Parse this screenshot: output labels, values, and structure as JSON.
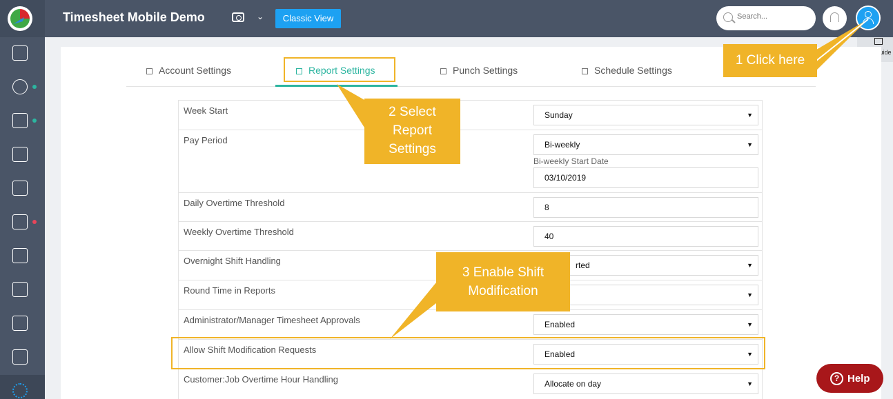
{
  "header": {
    "app_title": "Timesheet Mobile Demo",
    "classic_view_label": "Classic View",
    "search_placeholder": "Search..."
  },
  "page_guide": {
    "label": "page guide"
  },
  "tabs": [
    {
      "label": "Account Settings",
      "active": false
    },
    {
      "label": "Report Settings",
      "active": true
    },
    {
      "label": "Punch Settings",
      "active": false
    },
    {
      "label": "Schedule Settings",
      "active": false
    }
  ],
  "settings": [
    {
      "label": "Week Start",
      "value": "Sunday",
      "type": "select"
    },
    {
      "label": "Pay Period",
      "value": "Bi-weekly",
      "type": "select",
      "sublabel": "Bi-weekly Start Date",
      "subvalue": "03/10/2019"
    },
    {
      "label": "Daily Overtime Threshold",
      "value": "8",
      "type": "input"
    },
    {
      "label": "Weekly Overtime Threshold",
      "value": "40",
      "type": "input"
    },
    {
      "label": "Overnight Shift Handling",
      "value": "rted",
      "type": "select"
    },
    {
      "label": "Round Time in Reports",
      "value": "",
      "type": "select"
    },
    {
      "label": "Administrator/Manager Timesheet Approvals",
      "value": "Enabled",
      "type": "select"
    },
    {
      "label": "Allow Shift Modification Requests",
      "value": "Enabled",
      "type": "select"
    },
    {
      "label": "Customer:Job Overtime Hour Handling",
      "value": "Allocate on day",
      "type": "select"
    }
  ],
  "callouts": {
    "step1": "1 Click here",
    "step2": "2 Select Report Settings",
    "step3": "3 Enable Shift Modification"
  },
  "help": {
    "label": "Help",
    "icon_glyph": "?"
  },
  "colors": {
    "accent": "#2cb5a0",
    "brand_blue": "#1da1f2",
    "callout": "#f0b428",
    "topbar": "#4a5567",
    "help": "#a8171a"
  }
}
